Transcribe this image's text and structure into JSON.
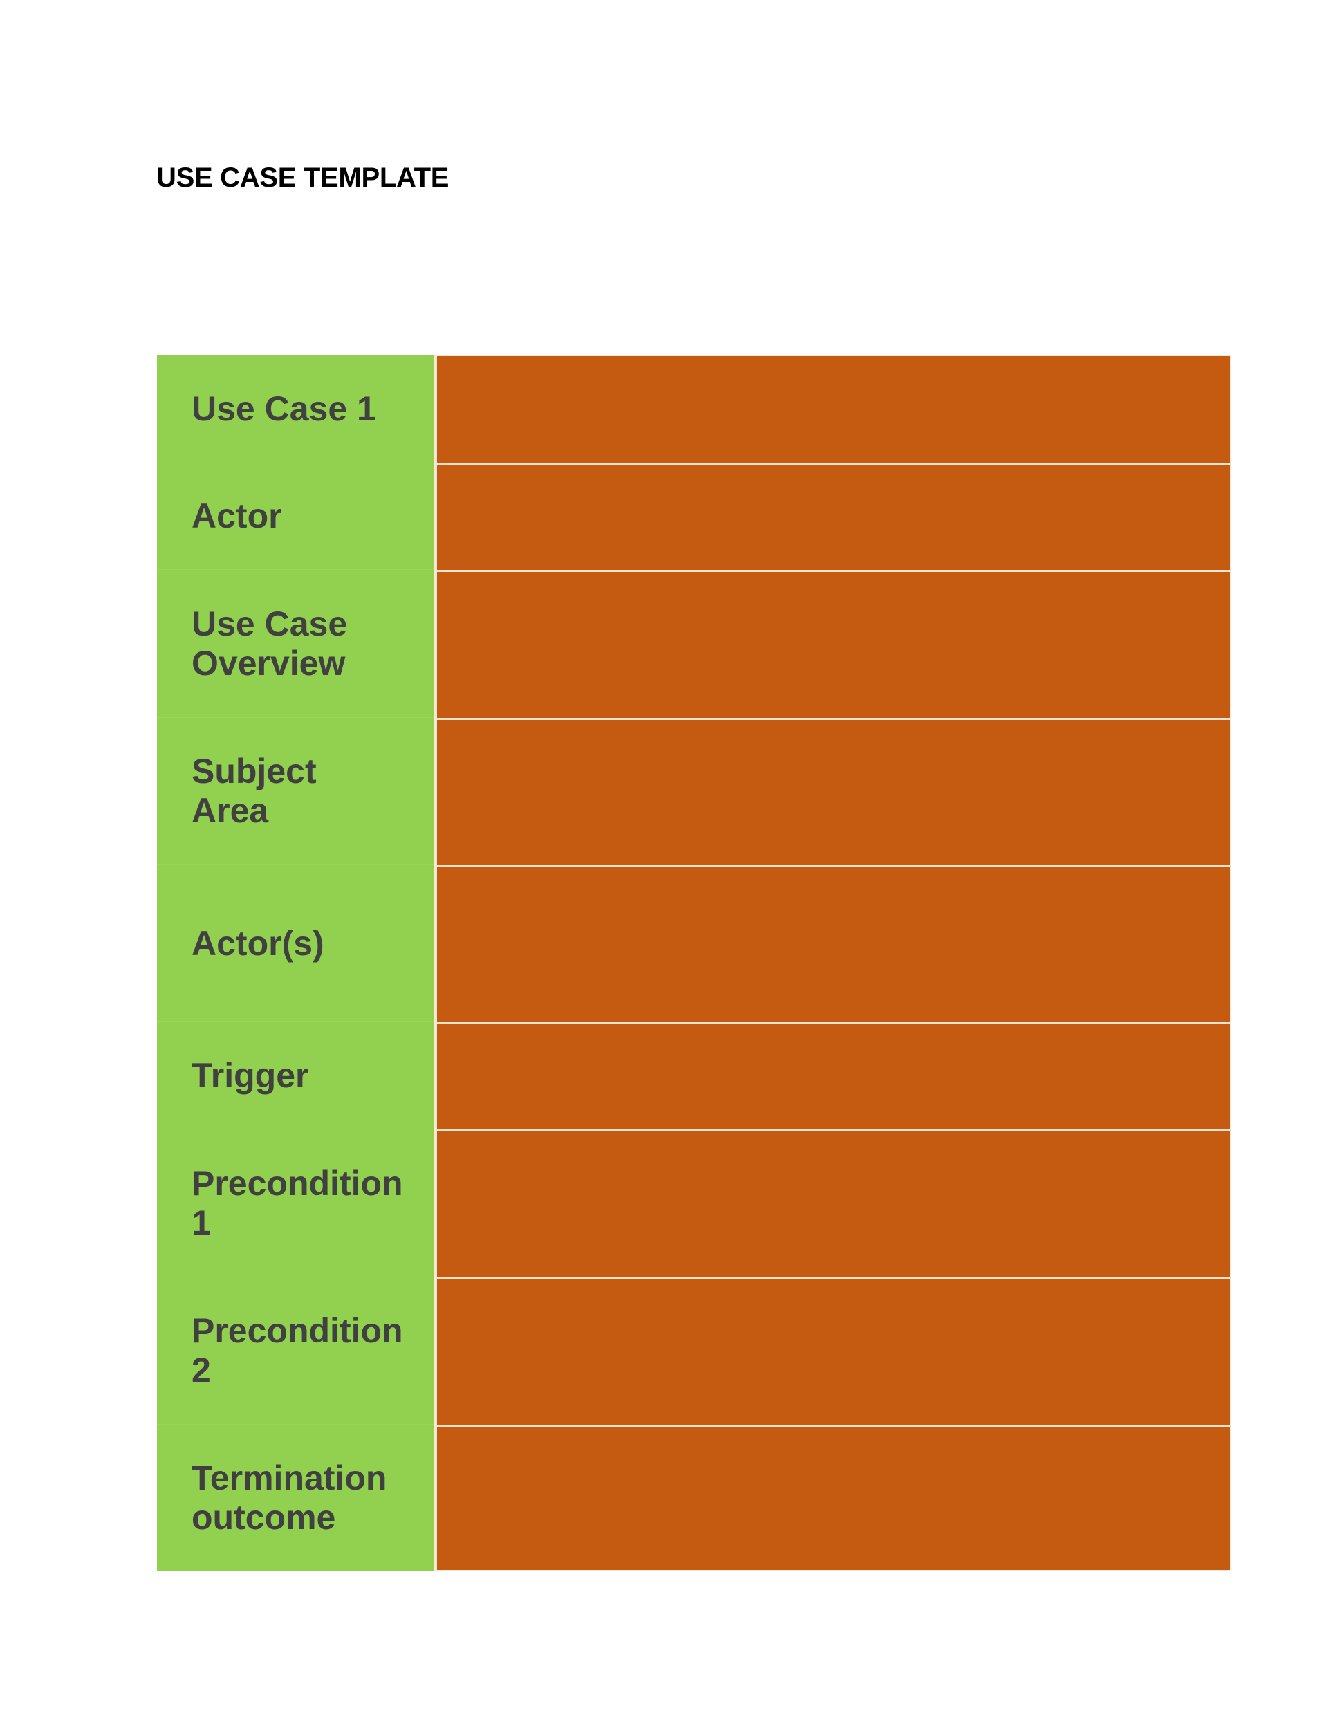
{
  "document": {
    "title": "USE CASE TEMPLATE"
  },
  "colors": {
    "label_background": "#92d050",
    "value_background": "#c55a11",
    "label_text": "#404040",
    "divider": "#fbe5d0"
  },
  "table": {
    "rows": [
      {
        "label_lines": [
          "Use Case 1"
        ],
        "value": ""
      },
      {
        "label_lines": [
          "Actor"
        ],
        "value": ""
      },
      {
        "label_lines": [
          "Use Case",
          "Overview"
        ],
        "value": ""
      },
      {
        "label_lines": [
          "Subject",
          "Area"
        ],
        "value": ""
      },
      {
        "label_lines": [
          "Actor(s)"
        ],
        "value": ""
      },
      {
        "label_lines": [
          "Trigger"
        ],
        "value": ""
      },
      {
        "label_lines": [
          "Precondition",
          "1"
        ],
        "value": ""
      },
      {
        "label_lines": [
          "Precondition",
          "2"
        ],
        "value": ""
      },
      {
        "label_lines": [
          "Termination",
          "outcome"
        ],
        "value": ""
      }
    ]
  }
}
